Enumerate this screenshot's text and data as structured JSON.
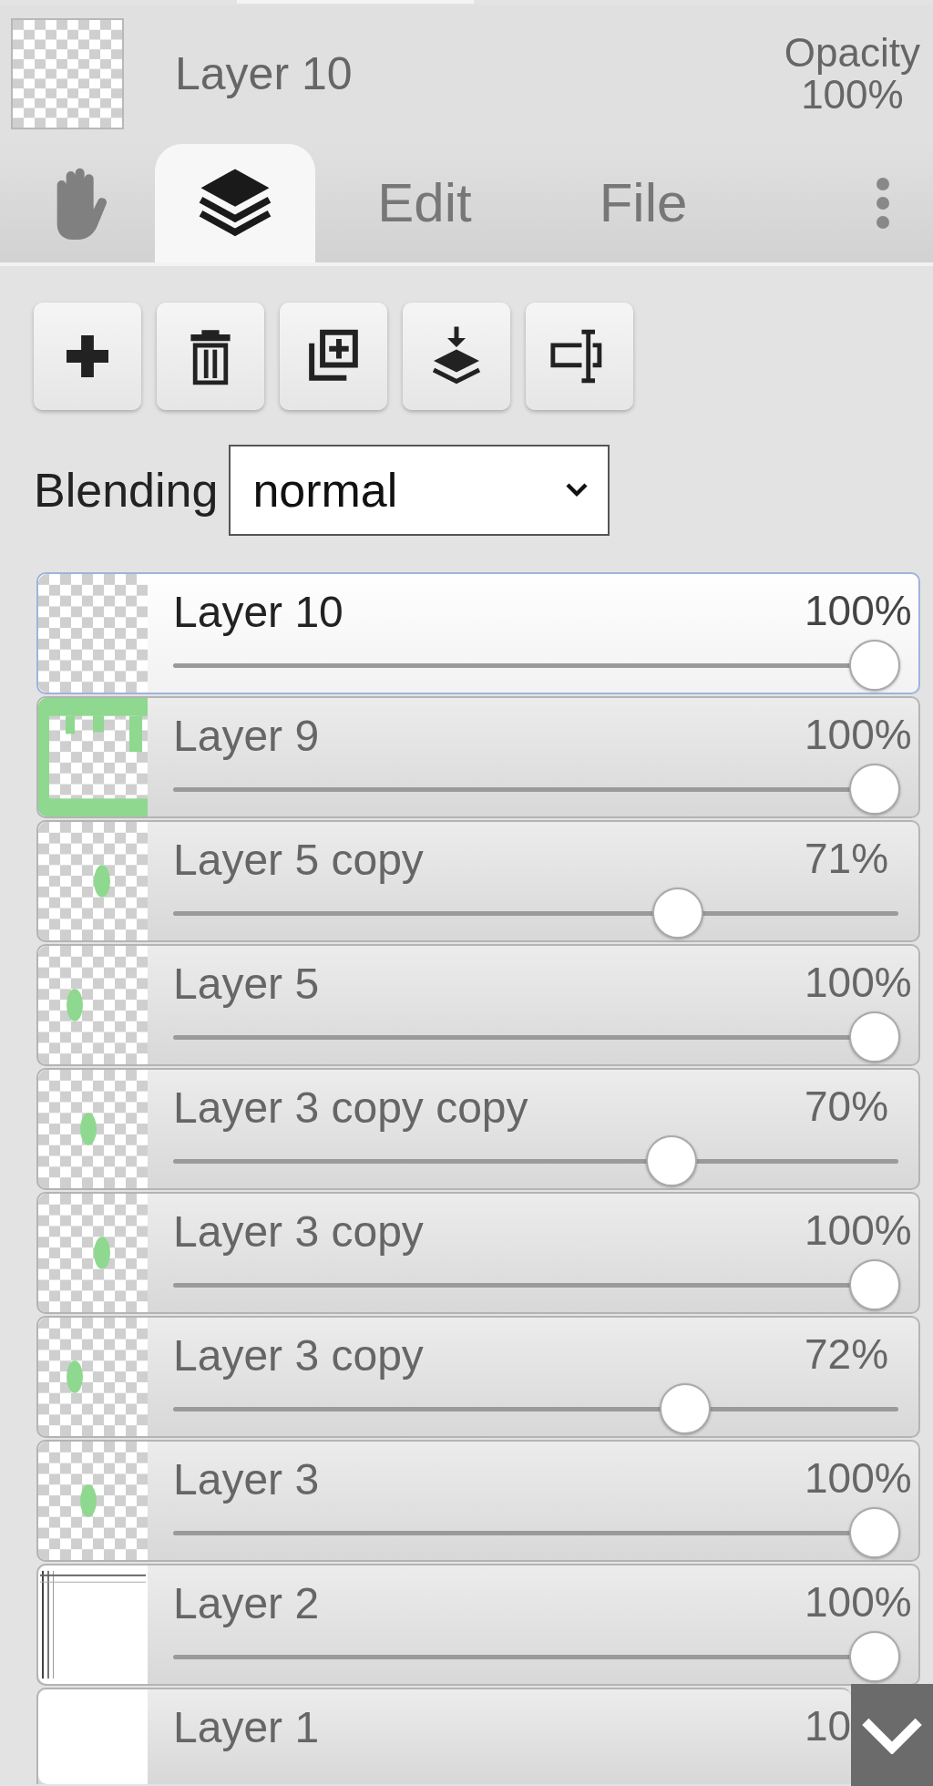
{
  "header": {
    "layer_name": "Layer 10",
    "opacity_label": "Opacity",
    "opacity_value": "100%"
  },
  "tabs": [
    {
      "kind": "hand",
      "selected": false
    },
    {
      "kind": "layers",
      "selected": true
    },
    {
      "kind": "text",
      "label": "Edit",
      "selected": false
    },
    {
      "kind": "text",
      "label": "File",
      "selected": false
    }
  ],
  "blending": {
    "label": "Blending",
    "value": "normal"
  },
  "layers": [
    {
      "name": "Layer 10",
      "opacity": "100%",
      "level": 1,
      "selected": true,
      "kind": "transparent"
    },
    {
      "name": "Layer 9",
      "opacity": "100%",
      "level": 1,
      "selected": false,
      "kind": "green_edge"
    },
    {
      "name": "Layer 5 copy",
      "opacity": "71%",
      "level": 0.71,
      "selected": false,
      "kind": "green_mark"
    },
    {
      "name": "Layer 5",
      "opacity": "100%",
      "level": 1,
      "selected": false,
      "kind": "green_mark"
    },
    {
      "name": "Layer 3 copy copy",
      "opacity": "70%",
      "level": 0.7,
      "selected": false,
      "kind": "green_mark"
    },
    {
      "name": "Layer 3 copy",
      "opacity": "100%",
      "level": 1,
      "selected": false,
      "kind": "green_mark"
    },
    {
      "name": "Layer 3 copy",
      "opacity": "72%",
      "level": 0.72,
      "selected": false,
      "kind": "green_mark"
    },
    {
      "name": "Layer 3",
      "opacity": "100%",
      "level": 1,
      "selected": false,
      "kind": "green_mark"
    },
    {
      "name": "Layer 2",
      "opacity": "100%",
      "level": 1,
      "selected": false,
      "kind": "lines"
    },
    {
      "name": "Layer 1",
      "opacity": "10",
      "selected": false,
      "kind": "white"
    }
  ]
}
